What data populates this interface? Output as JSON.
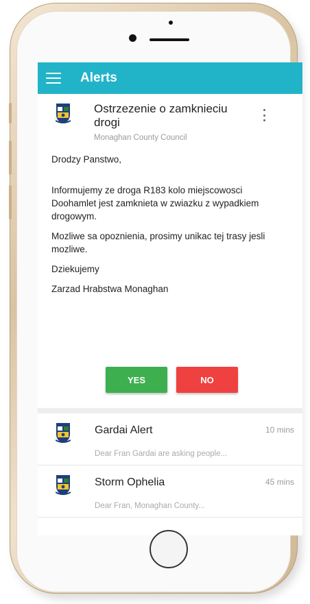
{
  "app": {
    "title": "Alerts"
  },
  "alert": {
    "title": "Ostrzezenie o zamknieciu drogi",
    "sender": "Monaghan County Council",
    "body": [
      "Drodzy Panstwo,",
      "Informujemy ze droga R183 kolo miejscowosci Doohamlet jest zamknieta w zwiazku z wypadkiem drogowym.",
      "Mozliwe sa opoznienia, prosimy unikac tej trasy jesli mozliwe.",
      "Dziekujemy",
      "Zarzad Hrabstwa Monaghan"
    ],
    "yes_label": "YES",
    "no_label": "NO"
  },
  "alerts_list": [
    {
      "title": "Gardai Alert",
      "time": "10 mins",
      "preview": "Dear Fran Gardai are asking people..."
    },
    {
      "title": "Storm Ophelia",
      "time": "45 mins",
      "preview": "Dear Fran, Monaghan County..."
    }
  ],
  "colors": {
    "appbar": "#21b4c8",
    "yes_button": "#3daf4f",
    "no_button": "#ee4140",
    "phone_frame": "#d9c3a2"
  },
  "icons": {
    "menu": "hamburger-menu-icon",
    "more": "more-vert-icon",
    "crest": "council-crest-icon"
  }
}
